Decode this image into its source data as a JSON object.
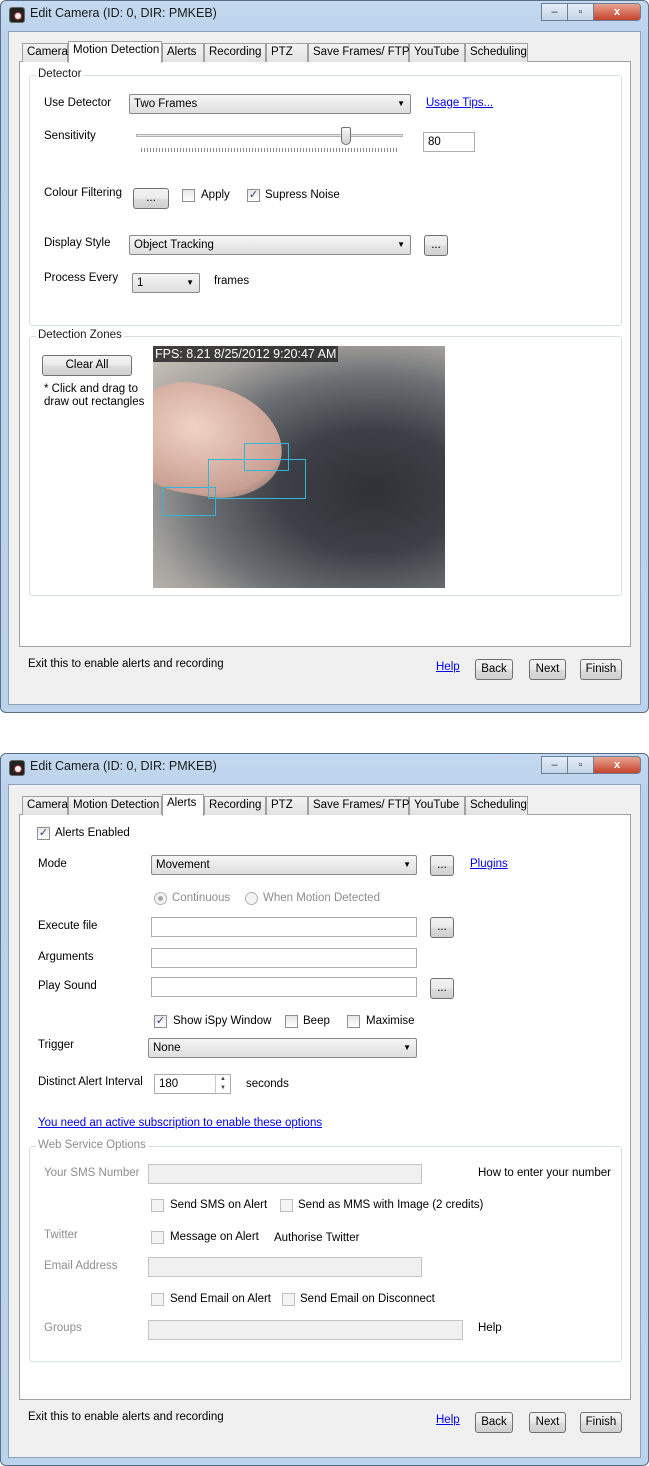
{
  "window_title": "Edit Camera (ID: 0, DIR: PMKEB)",
  "window_controls": {
    "minimize": "–",
    "maximize": "▫",
    "close": "x"
  },
  "tabs": [
    "Camera",
    "Motion Detection",
    "Alerts",
    "Recording",
    "PTZ",
    "Save Frames/ FTP",
    "YouTube",
    "Scheduling"
  ],
  "footer": {
    "note": "Exit this to enable alerts and recording",
    "help": "Help",
    "back": "Back",
    "next": "Next",
    "finish": "Finish"
  },
  "motion": {
    "detector_group": "Detector",
    "use_detector_label": "Use Detector",
    "use_detector_value": "Two Frames",
    "usage_tips": "Usage Tips...",
    "sensitivity_label": "Sensitivity",
    "sensitivity_value": "80",
    "sensitivity_percent": 80,
    "colour_filtering_label": "Colour Filtering",
    "ellipsis": "...",
    "apply_label": "Apply",
    "apply_checked": false,
    "supress_noise_label": "Supress Noise",
    "supress_noise_checked": true,
    "display_style_label": "Display Style",
    "display_style_value": "Object Tracking",
    "process_every_label": "Process Every",
    "process_every_value": "1",
    "frames_label": "frames",
    "zones_group": "Detection Zones",
    "clear_all": "Clear All",
    "zones_note_1": "* Click and drag to",
    "zones_note_2": "draw out rectangles",
    "fps_overlay": "FPS: 8.21 8/25/2012 9:20:47 AM"
  },
  "alerts": {
    "alerts_enabled_label": "Alerts Enabled",
    "alerts_enabled_checked": true,
    "mode_label": "Mode",
    "mode_value": "Movement",
    "ellipsis": "...",
    "plugins": "Plugins",
    "continuous": "Continuous",
    "when_motion": "When Motion Detected",
    "execute_file_label": "Execute file",
    "execute_file_value": "",
    "arguments_label": "Arguments",
    "arguments_value": "",
    "play_sound_label": "Play Sound",
    "play_sound_value": "",
    "show_window": "Show iSpy Window",
    "show_window_checked": true,
    "beep": "Beep",
    "beep_checked": false,
    "maximise": "Maximise",
    "maximise_checked": false,
    "trigger_label": "Trigger",
    "trigger_value": "None",
    "interval_label": "Distinct Alert Interval",
    "interval_value": "180",
    "seconds": "seconds",
    "subscription_link": "You need an active subscription to enable these options",
    "web_group": "Web Service Options",
    "sms_label": "Your SMS Number",
    "sms_help": "How to enter your number",
    "send_sms": "Send SMS on Alert",
    "send_mms": "Send as MMS with Image (2 credits)",
    "twitter_label": "Twitter",
    "message_on_alert": "Message on Alert",
    "authorise_twitter": "Authorise Twitter",
    "email_label": "Email Address",
    "send_email": "Send Email on Alert",
    "send_email_disconnect": "Send Email on Disconnect",
    "groups_label": "Groups",
    "groups_help": "Help"
  }
}
